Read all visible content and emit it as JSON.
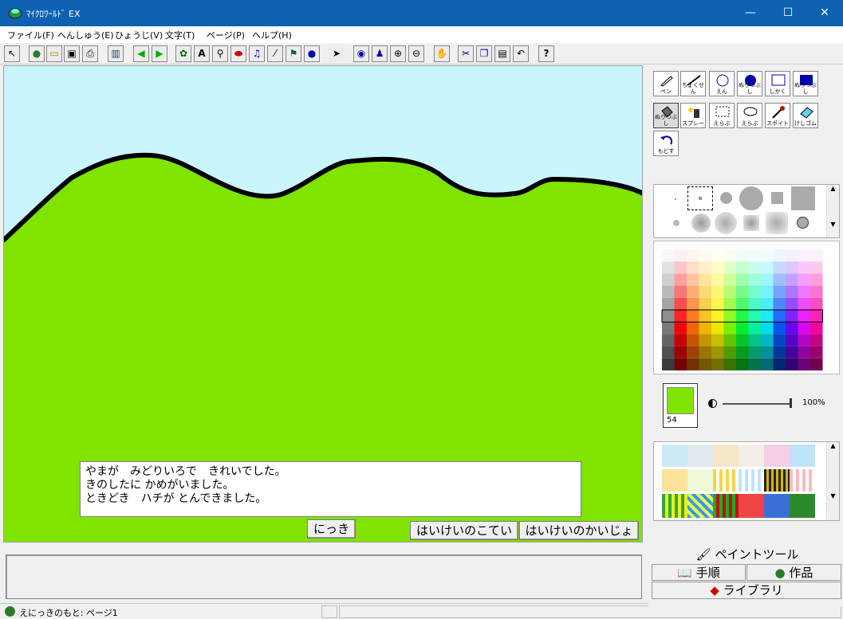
{
  "window": {
    "title": "ﾏｲｸﾛﾜｰﾙﾄﾞ EX",
    "minimize": "—",
    "maximize": "☐",
    "close": "✕"
  },
  "menu": [
    "ファイル(F)",
    "へんしゅう(E)",
    "ひょうじ(V)",
    "文字(T)",
    "ページ(P)",
    "ヘルプ(H)"
  ],
  "toolbar_icons": [
    "cursor-pointer-icon",
    "globe-icon",
    "open-folder-icon",
    "save-icon",
    "print-icon",
    "layout-icon",
    "arrow-left-icon",
    "arrow-right-icon",
    "character-icon",
    "text-a-icon",
    "microscope-icon",
    "eye-oval-icon",
    "music-note-icon",
    "magic-wand-icon",
    "film-icon",
    "animal-icon",
    "select-arrow-icon",
    "eye-icon",
    "stamp-icon",
    "zoom-in-icon",
    "zoom-out-icon",
    "hand-stop-icon",
    "scissors-icon",
    "copy-icon",
    "paste-icon",
    "undo-icon",
    "help-icon"
  ],
  "canvas": {
    "sky_color": "#c9f5fd",
    "hill_color": "#80e300",
    "text_lines": [
      "やまが　みどりいろで　きれいでした。",
      "きのしたに かめがいました。",
      "ときどき　ハチが とんできました。"
    ],
    "buttons": {
      "diary": "にっき",
      "bg_color": "はいけいのこてい",
      "bg_change": "はいけいのかいじょ"
    }
  },
  "tools": [
    {
      "label": "ペン",
      "icon": "pen-icon"
    },
    {
      "label": "ちょくせん",
      "icon": "line-icon"
    },
    {
      "label": "えん",
      "icon": "circle-icon"
    },
    {
      "label": "ぬりつぶし",
      "icon": "filled-circle-icon"
    },
    {
      "label": "しかく",
      "icon": "rectangle-icon"
    },
    {
      "label": "ぬりつぶし",
      "icon": "filled-rectangle-icon"
    },
    {
      "label": "ぬりつぶし",
      "icon": "paint-bucket-icon"
    },
    {
      "label": "スプレー",
      "icon": "spray-icon"
    },
    {
      "label": "えらぶ",
      "icon": "rect-select-icon"
    },
    {
      "label": "えらぶ",
      "icon": "lasso-icon"
    },
    {
      "label": "スポイト",
      "icon": "eyedropper-icon"
    },
    {
      "label": "けしゴム",
      "icon": "eraser-icon"
    },
    {
      "label": "もどす",
      "icon": "undo-arrow-icon"
    }
  ],
  "current_color": {
    "hex": "#80e300",
    "number": "54"
  },
  "opacity": "100%",
  "panel_tabs": {
    "paint": "ペイントツール",
    "steps": "手順",
    "works": "作品",
    "library": "ライブラリ"
  },
  "status": "えにっきのもと: ページ1",
  "colors": {
    "title_bar": "#0e62b1",
    "accent": "#80e300"
  }
}
